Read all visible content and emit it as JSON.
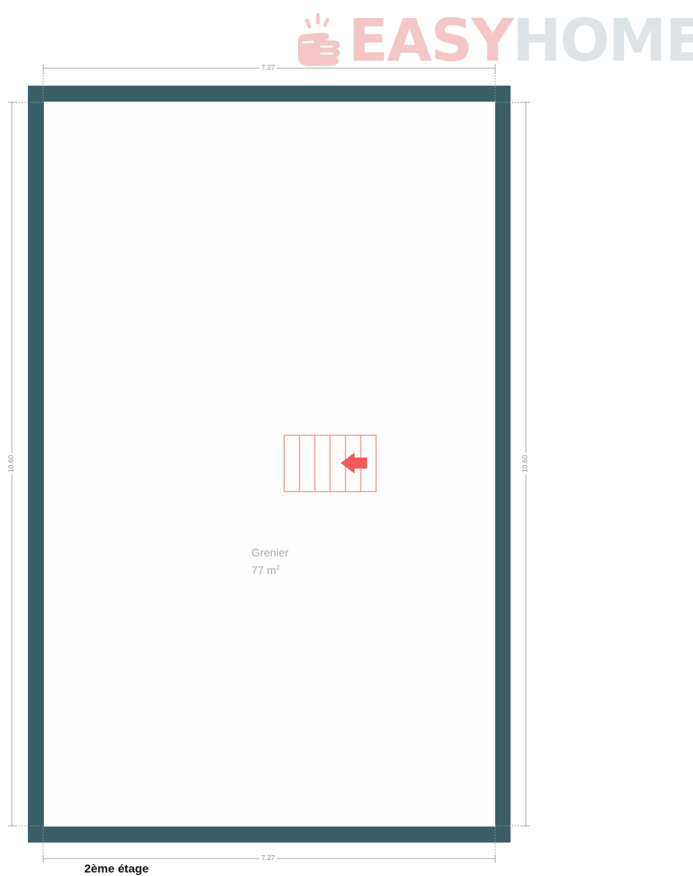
{
  "brand": {
    "word_easy": "EASY",
    "word_home": "HOME",
    "easy_color": "#f4c6c6",
    "home_color": "#dde3e6",
    "logo_icon": "hand-click-icon"
  },
  "plan": {
    "wall_color": "#3a5f68",
    "dim_top": "7.27",
    "dim_bottom": "7.27",
    "dim_left": "10.60",
    "dim_right": "10.60",
    "room_name": "Grenier",
    "room_area_value": "77 m",
    "room_area_unit_sup": "2",
    "stair_color": "#f05a5a",
    "stair_icon": "stairs-arrow-left-icon",
    "floor_label": "2ème étage"
  }
}
